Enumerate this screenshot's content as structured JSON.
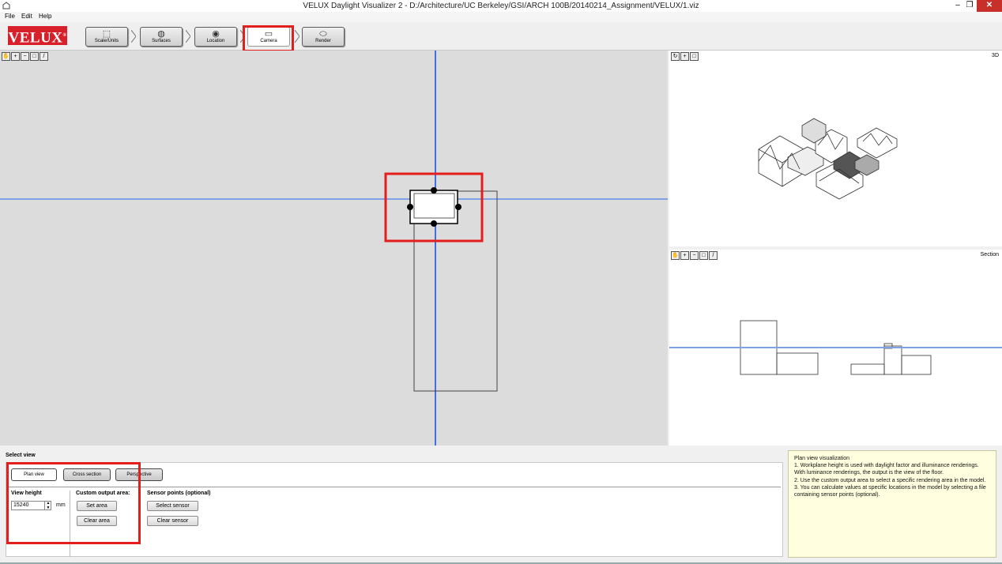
{
  "window": {
    "title": "VELUX Daylight Visualizer 2 - D:/Architecture/UC Berkeley/GSI/ARCH 100B/20140214_Assignment/VELUX/1.viz",
    "minimize": "–",
    "maximize": "❐",
    "close": "✕"
  },
  "menu": {
    "file": "File",
    "edit": "Edit",
    "help": "Help"
  },
  "toolbar": {
    "logo": "VELUX",
    "steps": [
      {
        "label": "Scale/Units",
        "icon": "box-icon"
      },
      {
        "label": "Surfaces",
        "icon": "palette-icon"
      },
      {
        "label": "Location",
        "icon": "globe-icon"
      },
      {
        "label": "Camera",
        "icon": "camera-icon"
      },
      {
        "label": "Render",
        "icon": "render-icon"
      }
    ],
    "active_step": "Camera"
  },
  "views": {
    "section_label": "Section",
    "threed_label": "3D"
  },
  "select_view": {
    "title": "Select view",
    "tabs": {
      "plan": "Plan view",
      "cross": "Cross section",
      "perspective": "Perspective"
    },
    "selected_tab": "Plan view",
    "view_height": {
      "label": "View height",
      "value": "15240",
      "unit": "mm"
    },
    "custom_output": {
      "label": "Custom output area:",
      "set": "Set area",
      "clear": "Clear area"
    },
    "sensor": {
      "label": "Sensor points (optional)",
      "select": "Select sensor",
      "clear": "Clear sensor"
    }
  },
  "help": {
    "title": "Plan view visualization",
    "lines": [
      "1. Workplane height is used with daylight factor and illuminance renderings. With luminance renderings, the output is the view of the floor.",
      "2. Use the custom output area to select a specific rendering area in the model.",
      "3. You can calculate values at specific locations in the model by selecting a file containing sensor points (optional)."
    ]
  },
  "colors": {
    "accent_red": "#e41d1d",
    "velux_red": "#d8202b",
    "axis_blue": "#3f6fe0",
    "help_bg": "#ffffe0"
  }
}
